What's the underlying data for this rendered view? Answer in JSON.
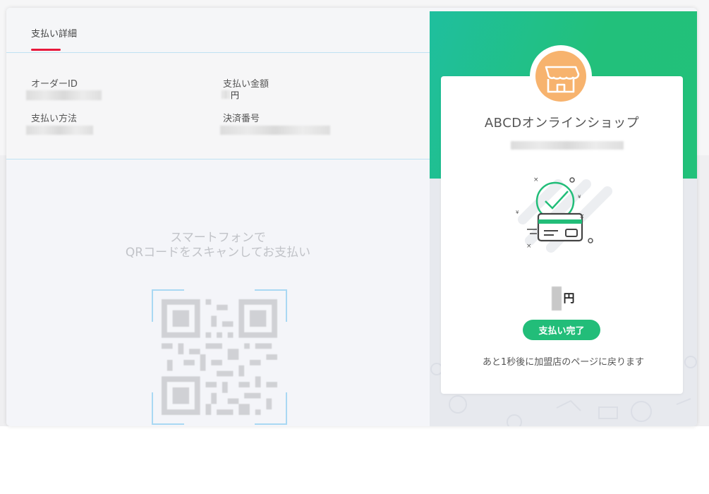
{
  "details": {
    "tab_label": "支払い詳細",
    "order_id_label": "オーダーID",
    "amount_label": "支払い金額",
    "amount_unit": "円",
    "method_label": "支払い方法",
    "settlement_label": "決済番号"
  },
  "scan": {
    "line1": "スマートフォンで",
    "line2": "QRコードをスキャンしてお支払い"
  },
  "shop": {
    "name": "ABCDオンラインショップ",
    "icon": "store-icon"
  },
  "result": {
    "amount_unit": "円",
    "status_button": "支払い完了",
    "redirect_message": "あと1秒後に加盟店のページに戻ります",
    "illustration": "payment-success-card-icon"
  },
  "colors": {
    "accent_red": "#e8193c",
    "green": "#22bd79",
    "teal": "#1fbf9e",
    "shop_orange": "#f7b36e"
  }
}
